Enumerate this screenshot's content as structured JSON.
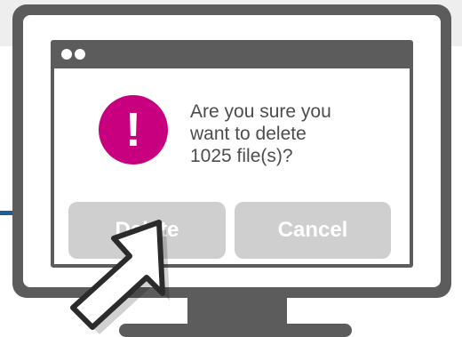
{
  "dialog": {
    "message_line_1": "Are you sure you",
    "message_line_2": "want to delete",
    "message_line_3": "1025 file(s)?",
    "alert_symbol": "!",
    "delete_label": "Delete",
    "cancel_label": "Cancel"
  },
  "icons": {
    "alert": "exclamation-icon",
    "cursor": "hand-pointer-icon",
    "window_controls": "window-dots-icon"
  },
  "colors": {
    "monitor": "#5c5c5c",
    "alert": "#c8007f",
    "button": "#cfcfcf",
    "text": "#4d4d4d",
    "accent_line": "#1f5c9c"
  }
}
